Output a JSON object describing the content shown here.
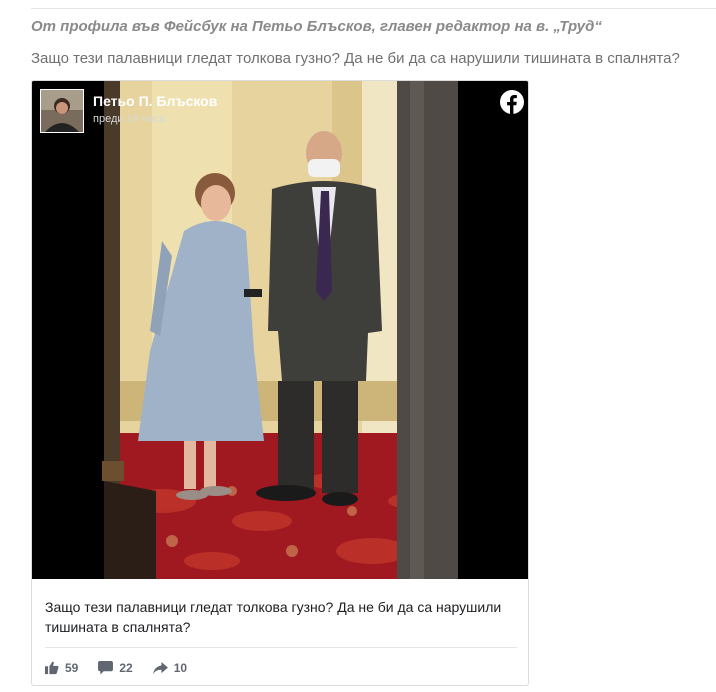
{
  "article": {
    "intro": "От профила във Фейсбук на Петьо Блъсков, главен редактор на в. „Труд“",
    "lead": "Защо тези палавници гледат толкова гузно? Да не би да са нарушили тишината в спалнята?"
  },
  "post": {
    "author": "Петьо П. Блъсков",
    "time": "преди 14 часа",
    "text": "Защо тези палавници гледат толкова гузно? Да не би да са нарушили тишината в спалнята?",
    "likes": "59",
    "comments": "22",
    "shares": "10"
  },
  "icons": {
    "platform": "facebook-logo-icon",
    "like": "thumbs-up-icon",
    "comment": "speech-bubble-icon",
    "share": "share-arrow-icon"
  },
  "colors": {
    "facebook_blue": "#1877f2",
    "carpet_red": "#a01820",
    "wall_cream": "#e8d6a0"
  }
}
